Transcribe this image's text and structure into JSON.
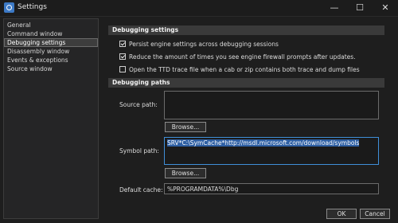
{
  "window": {
    "title": "Settings"
  },
  "nav": {
    "items": [
      {
        "label": "General",
        "selected": false
      },
      {
        "label": "Command window",
        "selected": false
      },
      {
        "label": "Debugging settings",
        "selected": true
      },
      {
        "label": "Disassembly window",
        "selected": false
      },
      {
        "label": "Events & exceptions",
        "selected": false
      },
      {
        "label": "Source window",
        "selected": false
      }
    ]
  },
  "debugging_settings": {
    "header": "Debugging settings",
    "options": [
      {
        "label": "Persist engine settings across debugging sessions",
        "checked": true
      },
      {
        "label": "Reduce the amount of times you see engine firewall prompts after updates.",
        "checked": true
      },
      {
        "label": "Open the TTD trace file when a cab or zip contains both trace and dump files",
        "checked": false
      }
    ]
  },
  "debugging_paths": {
    "header": "Debugging paths",
    "source_path": {
      "label": "Source path:",
      "value": "",
      "browse_label": "Browse..."
    },
    "symbol_path": {
      "label": "Symbol path:",
      "value": "SRV*C:\\SymCache*http://msdl.microsoft.com/download/symbols",
      "browse_label": "Browse..."
    },
    "default_cache": {
      "label": "Default cache:",
      "value": "%PROGRAMDATA%\\Dbg"
    }
  },
  "footer": {
    "ok_label": "OK",
    "cancel_label": "Cancel"
  },
  "colors": {
    "accent": "#3f8fd8",
    "selection": "#2e5fa3",
    "background": "#1e1e1e"
  }
}
